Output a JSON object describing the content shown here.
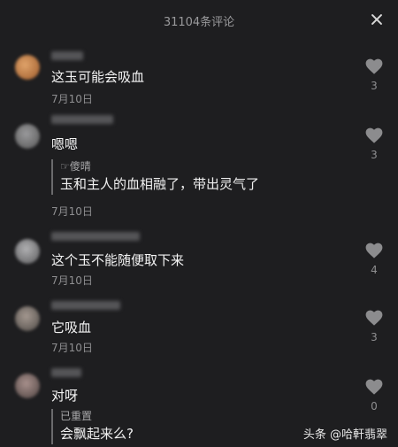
{
  "header": {
    "title": "31104条评论"
  },
  "comments": [
    {
      "text": "这玉可能会吸血",
      "date": "7月10日",
      "likes": "3",
      "avatar_color": "#c98a4c"
    },
    {
      "text": "嗯嗯",
      "reply_name": "☞傻晴",
      "reply_text": "玉和主人的血相融了，带出灵气了",
      "date": "7月10日",
      "likes": "3",
      "avatar_color": "#7a7a7c"
    },
    {
      "text": "这个玉不能随便取下来",
      "date": "7月10日",
      "likes": "4",
      "avatar_color": "#8a8a8c"
    },
    {
      "text": "它吸血",
      "date": "7月10日",
      "likes": "3",
      "avatar_color": "#6e6a66"
    },
    {
      "text": "对呀",
      "reply_name": "已重置",
      "reply_text": "会飘起来么?",
      "likes": "0",
      "avatar_color": "#7d6e6c"
    }
  ],
  "watermark": "头条 @哈軒翡翠"
}
